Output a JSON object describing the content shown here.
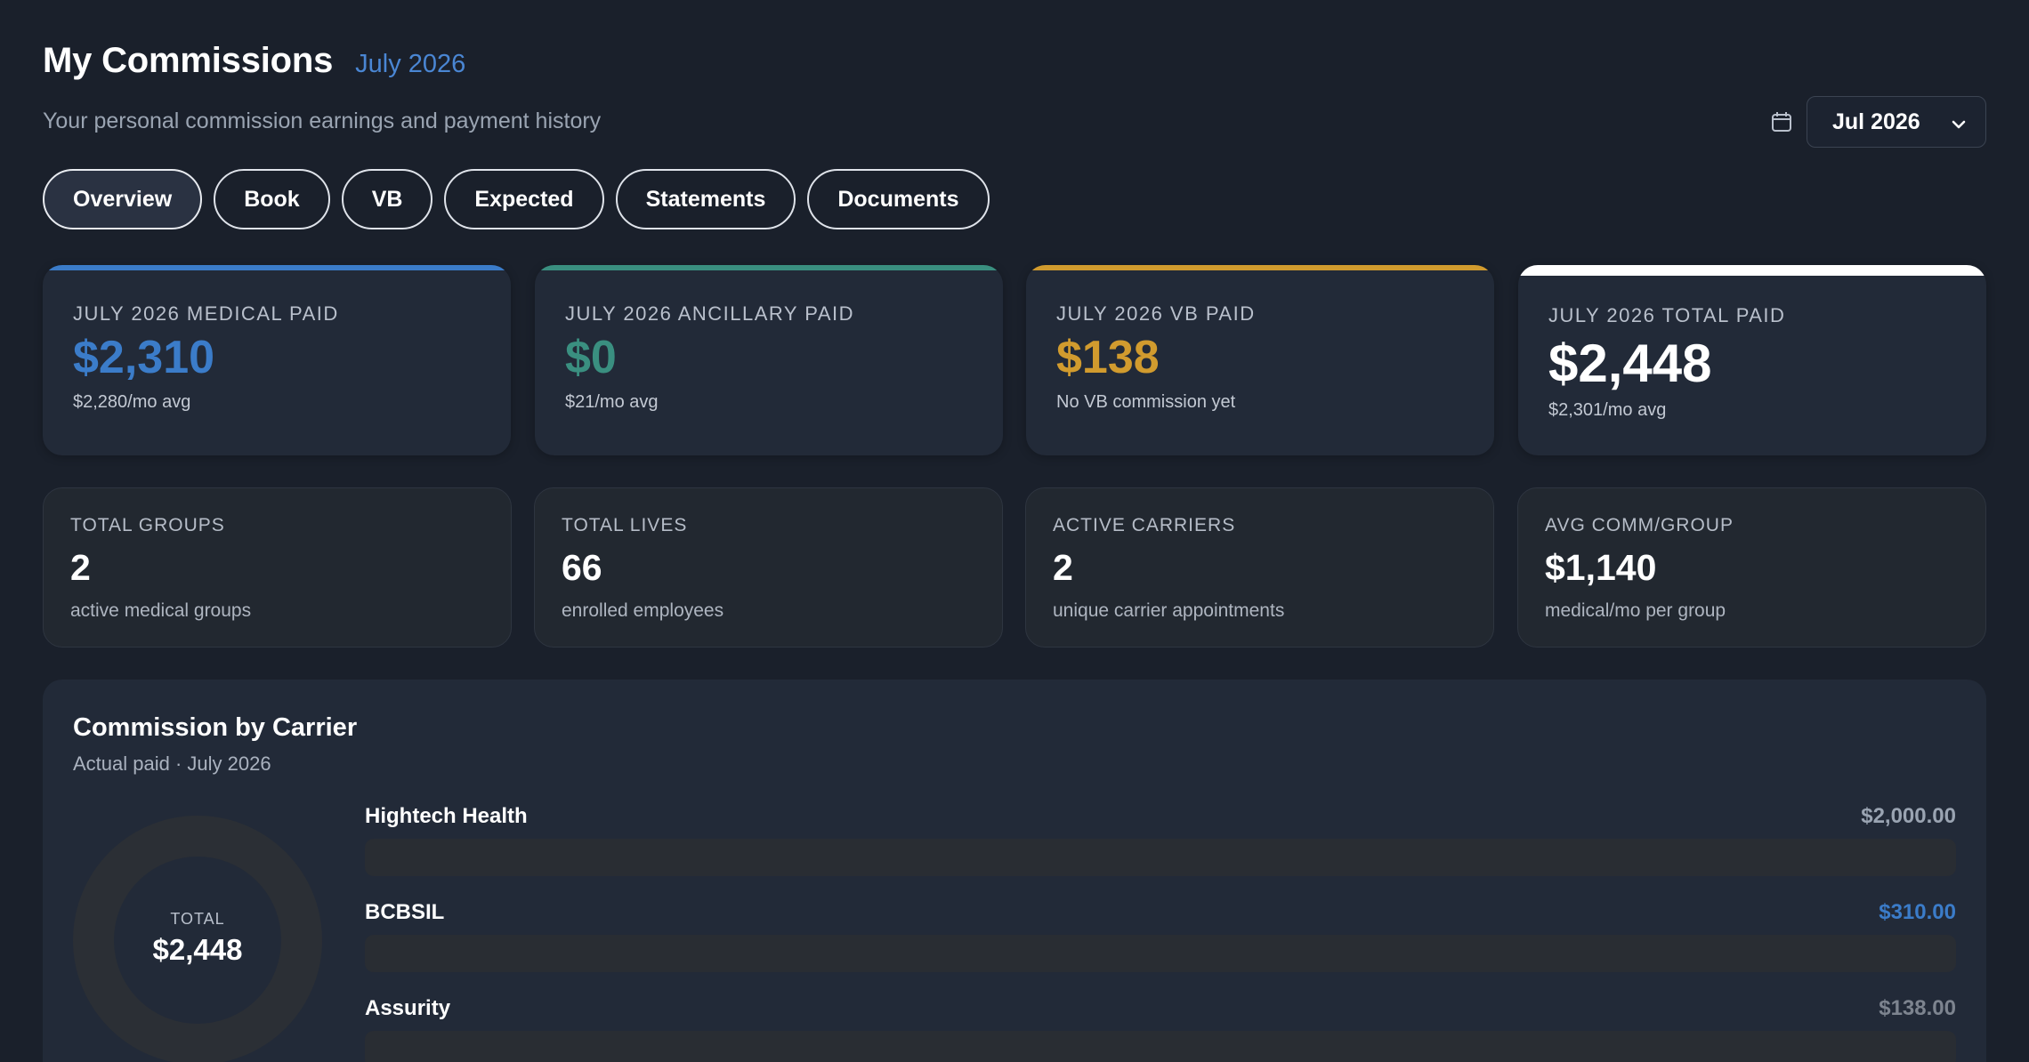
{
  "header": {
    "title": "My Commissions",
    "period": "July 2026",
    "subtitle": "Your personal commission earnings and payment history"
  },
  "month_picker": {
    "icon": "calendar-icon",
    "selected": "Jul 2026"
  },
  "tabs": [
    {
      "label": "Overview",
      "active": true
    },
    {
      "label": "Book",
      "active": false
    },
    {
      "label": "VB",
      "active": false
    },
    {
      "label": "Expected",
      "active": false
    },
    {
      "label": "Statements",
      "active": false
    },
    {
      "label": "Documents",
      "active": false
    }
  ],
  "kpis": [
    {
      "label": "JULY 2026 MEDICAL PAID",
      "value": "$2,310",
      "sub": "$2,280/mo avg",
      "color": "#3b7cc9"
    },
    {
      "label": "JULY 2026 ANCILLARY PAID",
      "value": "$0",
      "sub": "$21/mo avg",
      "color": "#3a8f80"
    },
    {
      "label": "JULY 2026 VB PAID",
      "value": "$138",
      "sub": "No VB commission yet",
      "color": "#d19b2e"
    },
    {
      "label": "JULY 2026 TOTAL PAID",
      "value": "$2,448",
      "sub": "$2,301/mo avg",
      "color": "#ffffff"
    }
  ],
  "stats": [
    {
      "label": "TOTAL GROUPS",
      "value": "2",
      "sub": "active medical groups"
    },
    {
      "label": "TOTAL LIVES",
      "value": "66",
      "sub": "enrolled employees"
    },
    {
      "label": "ACTIVE CARRIERS",
      "value": "2",
      "sub": "unique carrier appointments"
    },
    {
      "label": "AVG COMM/GROUP",
      "value": "$1,140",
      "sub": "medical/mo per group"
    }
  ],
  "carrier_panel": {
    "title": "Commission by Carrier",
    "subtitle": "Actual paid · July 2026",
    "donut_caption": "TOTAL",
    "donut_total": "$2,448",
    "carriers": [
      {
        "name": "Hightech Health",
        "amount": "$2,000.00",
        "value": 2000,
        "color": "#9aa4b2"
      },
      {
        "name": "BCBSIL",
        "amount": "$310.00",
        "value": 310,
        "color": "#3b7cc9"
      },
      {
        "name": "Assurity",
        "amount": "$138.00",
        "value": 138,
        "color": "#7d848f"
      }
    ]
  }
}
